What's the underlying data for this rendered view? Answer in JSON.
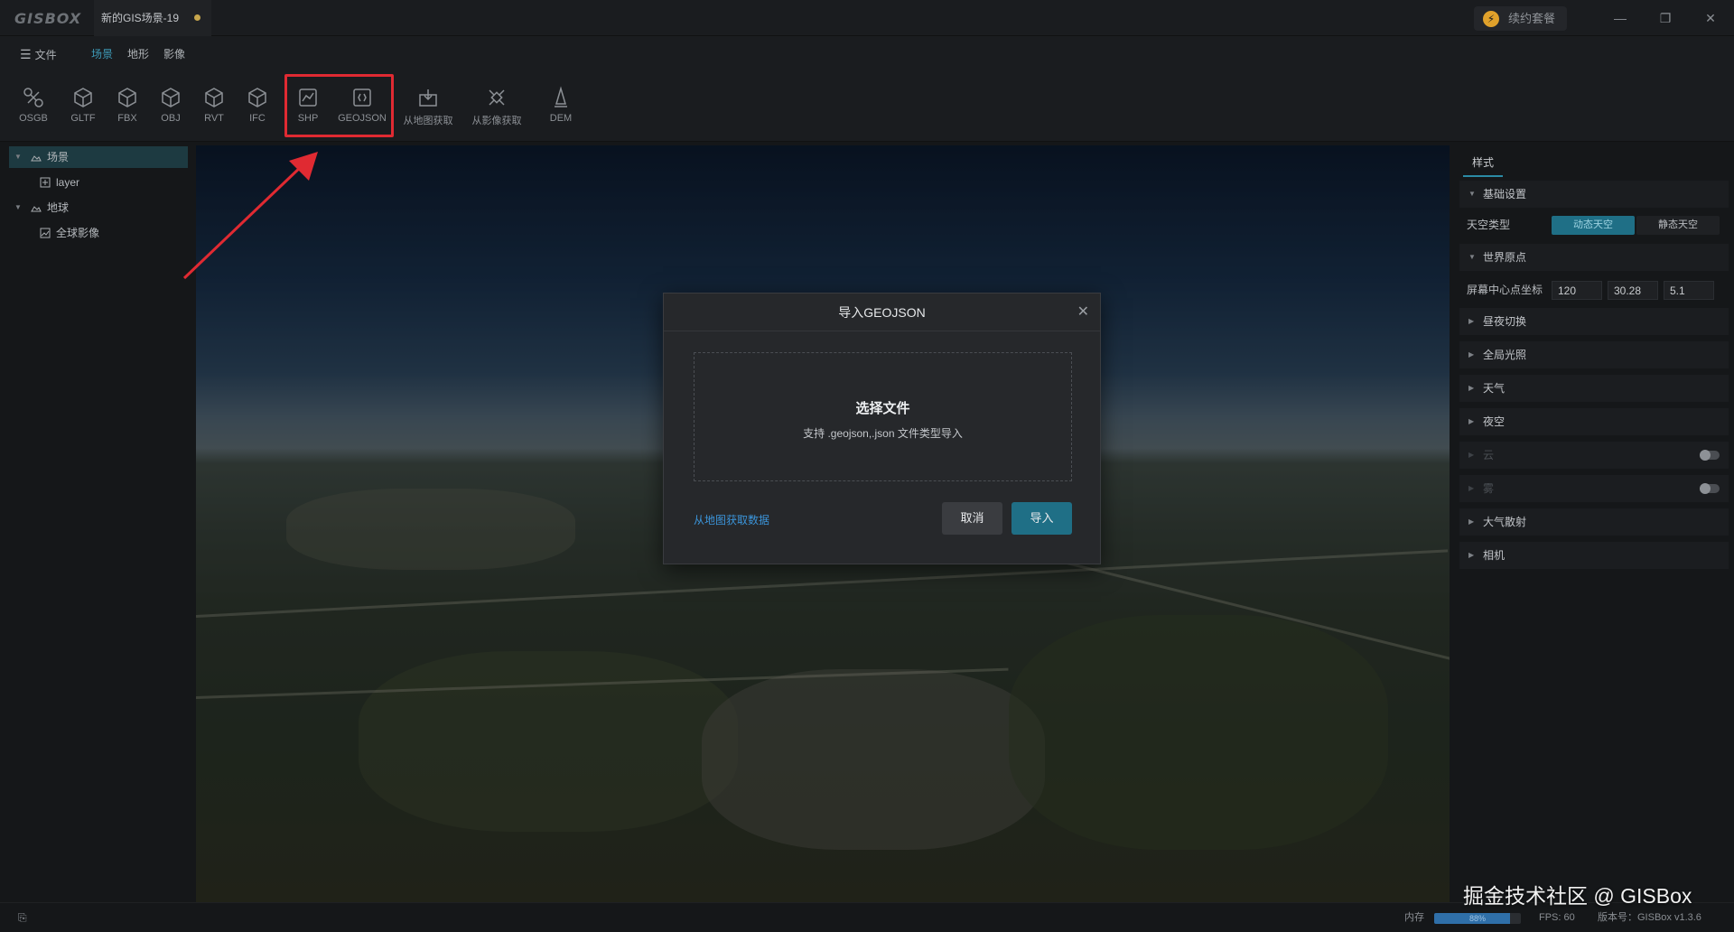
{
  "app": {
    "logo": "GISBOX",
    "document_tab": "新的GIS场景-19",
    "renew_button": "续约套餐"
  },
  "menu": {
    "file": "文件",
    "tabs": [
      "场景",
      "地形",
      "影像"
    ],
    "active_tab": "场景"
  },
  "toolbar": {
    "items": [
      {
        "label": "OSGB",
        "icon": "osgb-icon"
      },
      {
        "label": "GLTF",
        "icon": "gltf-cube-icon"
      },
      {
        "label": "FBX",
        "icon": "fbx-cube-icon"
      },
      {
        "label": "OBJ",
        "icon": "obj-cube-icon"
      },
      {
        "label": "RVT",
        "icon": "rvt-cube-icon"
      },
      {
        "label": "IFC",
        "icon": "ifc-cube-icon"
      },
      {
        "label": "SHP",
        "icon": "shp-chart-icon"
      },
      {
        "label": "GEOJSON",
        "icon": "geojson-icon"
      },
      {
        "label": "从地图获取",
        "icon": "map-fetch-icon"
      },
      {
        "label": "从影像获取",
        "icon": "imagery-fetch-icon"
      },
      {
        "label": "DEM",
        "icon": "dem-icon"
      }
    ],
    "highlighted": [
      "SHP",
      "GEOJSON"
    ],
    "highlight_color": "#e02a32"
  },
  "tree": {
    "items": [
      {
        "label": "场景",
        "level": 0,
        "selected": true
      },
      {
        "label": "layer",
        "level": 1
      },
      {
        "label": "地球",
        "level": 0
      },
      {
        "label": "全球影像",
        "level": 1
      }
    ]
  },
  "modal": {
    "title": "导入GEOJSON",
    "drop_title": "选择文件",
    "drop_hint": "支持 .geojson,.json 文件类型导入",
    "map_link": "从地图获取数据",
    "cancel": "取消",
    "import": "导入"
  },
  "right_panel": {
    "tab": "样式",
    "sections": {
      "basic": "基础设置",
      "sky_type_label": "天空类型",
      "sky_dynamic": "动态天空",
      "sky_static": "静态天空",
      "world_origin": "世界原点",
      "screen_center_label": "屏幕中心点坐标",
      "coords": [
        "120",
        "30.28",
        "5.1"
      ],
      "day_night": "昼夜切换",
      "global_light": "全局光照",
      "weather": "天气",
      "night_sky": "夜空",
      "cloud": "云",
      "fog": "雾",
      "atmosphere": "大气散射",
      "camera": "相机"
    }
  },
  "status": {
    "memory_label": "内存",
    "memory_value": "88%",
    "memory_fraction": 0.88,
    "fps": "FPS: 60",
    "version": "版本号：GISBox v1.3.6"
  },
  "watermark": "掘金技术社区 @ GISBox",
  "colors": {
    "accent": "#1f6f86",
    "link": "#3b94d9",
    "highlight": "#e02a32"
  }
}
